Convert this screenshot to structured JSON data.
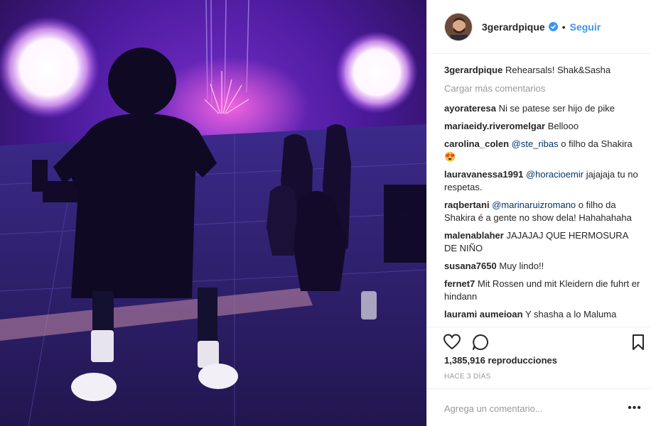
{
  "header": {
    "username": "3gerardpique",
    "separator": "•",
    "follow_label": "Seguir"
  },
  "caption": {
    "username": "3gerardpique",
    "text": "Rehearsals! Shak&Sasha"
  },
  "load_more_label": "Cargar más comentarios",
  "comments": [
    {
      "user": "ayorateresa",
      "mention": "",
      "text": "Ni se patese ser hijo de pike"
    },
    {
      "user": "mariaeidy.riveromelgar",
      "mention": "",
      "text": "Bellooo"
    },
    {
      "user": "carolina_colen",
      "mention": "@ste_ribas",
      "text": "o filho da Shakira 😍"
    },
    {
      "user": "lauravanessa1991",
      "mention": "@horacioemir",
      "text": "jajajaja tu no respetas."
    },
    {
      "user": "raqbertani",
      "mention": "@marinaruizromano",
      "text": "o filho da Shakira é a gente no show dela! Hahahahaha"
    },
    {
      "user": "malenablaher",
      "mention": "",
      "text": "JAJAJAJ QUE HERMOSURA DE NIÑO"
    },
    {
      "user": "susana7650",
      "mention": "",
      "text": "Muy lindo!!"
    },
    {
      "user": "fernet7",
      "mention": "",
      "text": "Mit Rossen und mit Kleidern die fuhrt er hindann"
    },
    {
      "user": "laurami aumeioan",
      "mention": "",
      "text": "Y shasha a lo Maluma"
    }
  ],
  "stats": {
    "views": "1,385,916 reproducciones",
    "date": "HACE 3 DÍAS"
  },
  "add_comment": {
    "placeholder": "Agrega un comentario...",
    "more_label": "•••"
  },
  "icons": {
    "like": "heart-icon",
    "comment": "comment-bubble-icon",
    "save": "bookmark-icon",
    "verified": "verified-badge-icon"
  },
  "colors": {
    "link_blue": "#3897f0",
    "verified_blue": "#3897f0",
    "mention": "#003569",
    "muted": "#999999"
  }
}
